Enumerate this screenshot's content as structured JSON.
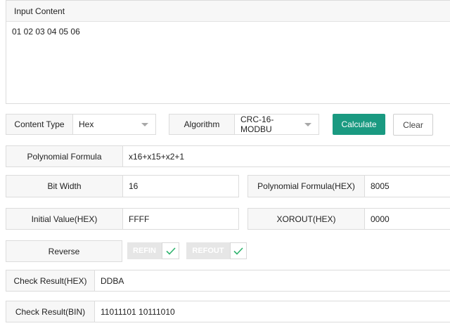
{
  "input": {
    "header": "Input Content",
    "value": "01 02 03 04 05 06"
  },
  "controls": {
    "content_type_label": "Content Type",
    "content_type_value": "Hex",
    "algorithm_label": "Algorithm",
    "algorithm_value": "CRC-16-MODBU",
    "calculate_label": "Calculate",
    "clear_label": "Clear"
  },
  "params": {
    "polynomial_formula_label": "Polynomial Formula",
    "polynomial_formula_value": "x16+x15+x2+1",
    "bit_width_label": "Bit Width",
    "bit_width_value": "16",
    "polynomial_hex_label": "Polynomial Formula(HEX)",
    "polynomial_hex_value": "8005",
    "initial_value_label": "Initial Value(HEX)",
    "initial_value_value": "FFFF",
    "xorout_label": "XOROUT(HEX)",
    "xorout_value": "0000",
    "reverse_label": "Reverse",
    "refin_label": "REFIN",
    "refout_label": "REFOUT"
  },
  "results": {
    "hex_label": "Check Result(HEX)",
    "hex_value": "DDBA",
    "bin_label": "Check Result(BIN)",
    "bin_value": "11011101 10111010"
  },
  "colors": {
    "accent": "#1a9a81",
    "check": "#2fb36e"
  },
  "icons": {
    "dropdown": "chevron-down-icon",
    "toggle_on": "checkmark-icon"
  }
}
